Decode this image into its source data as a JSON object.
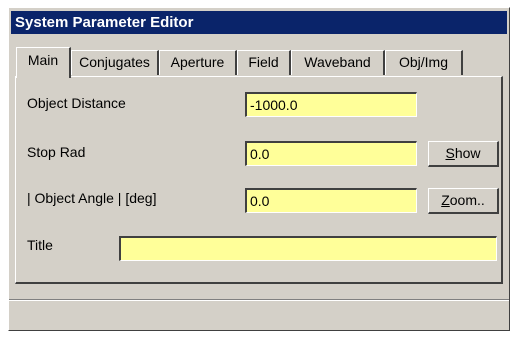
{
  "window": {
    "title": "System Parameter Editor"
  },
  "tabs": [
    {
      "label": "Main",
      "active": true
    },
    {
      "label": "Conjugates",
      "active": false
    },
    {
      "label": "Aperture",
      "active": false
    },
    {
      "label": "Field",
      "active": false
    },
    {
      "label": "Waveband",
      "active": false
    },
    {
      "label": "Obj/Img",
      "active": false
    }
  ],
  "form": {
    "object_distance": {
      "label": "Object Distance",
      "value": "-1000.0"
    },
    "stop_rad": {
      "label": "Stop Rad",
      "value": "0.0"
    },
    "object_angle": {
      "label": "| Object Angle |  [deg]",
      "value": "0.0"
    },
    "title": {
      "label": "Title",
      "value": ""
    }
  },
  "buttons": {
    "show": {
      "accel": "S",
      "rest": "how"
    },
    "zoom": {
      "accel": "Z",
      "rest": "oom.."
    }
  },
  "colors": {
    "titlebar": "#0a246a",
    "field_background": "#ffff99",
    "dialog_background": "#d4d0c8"
  }
}
